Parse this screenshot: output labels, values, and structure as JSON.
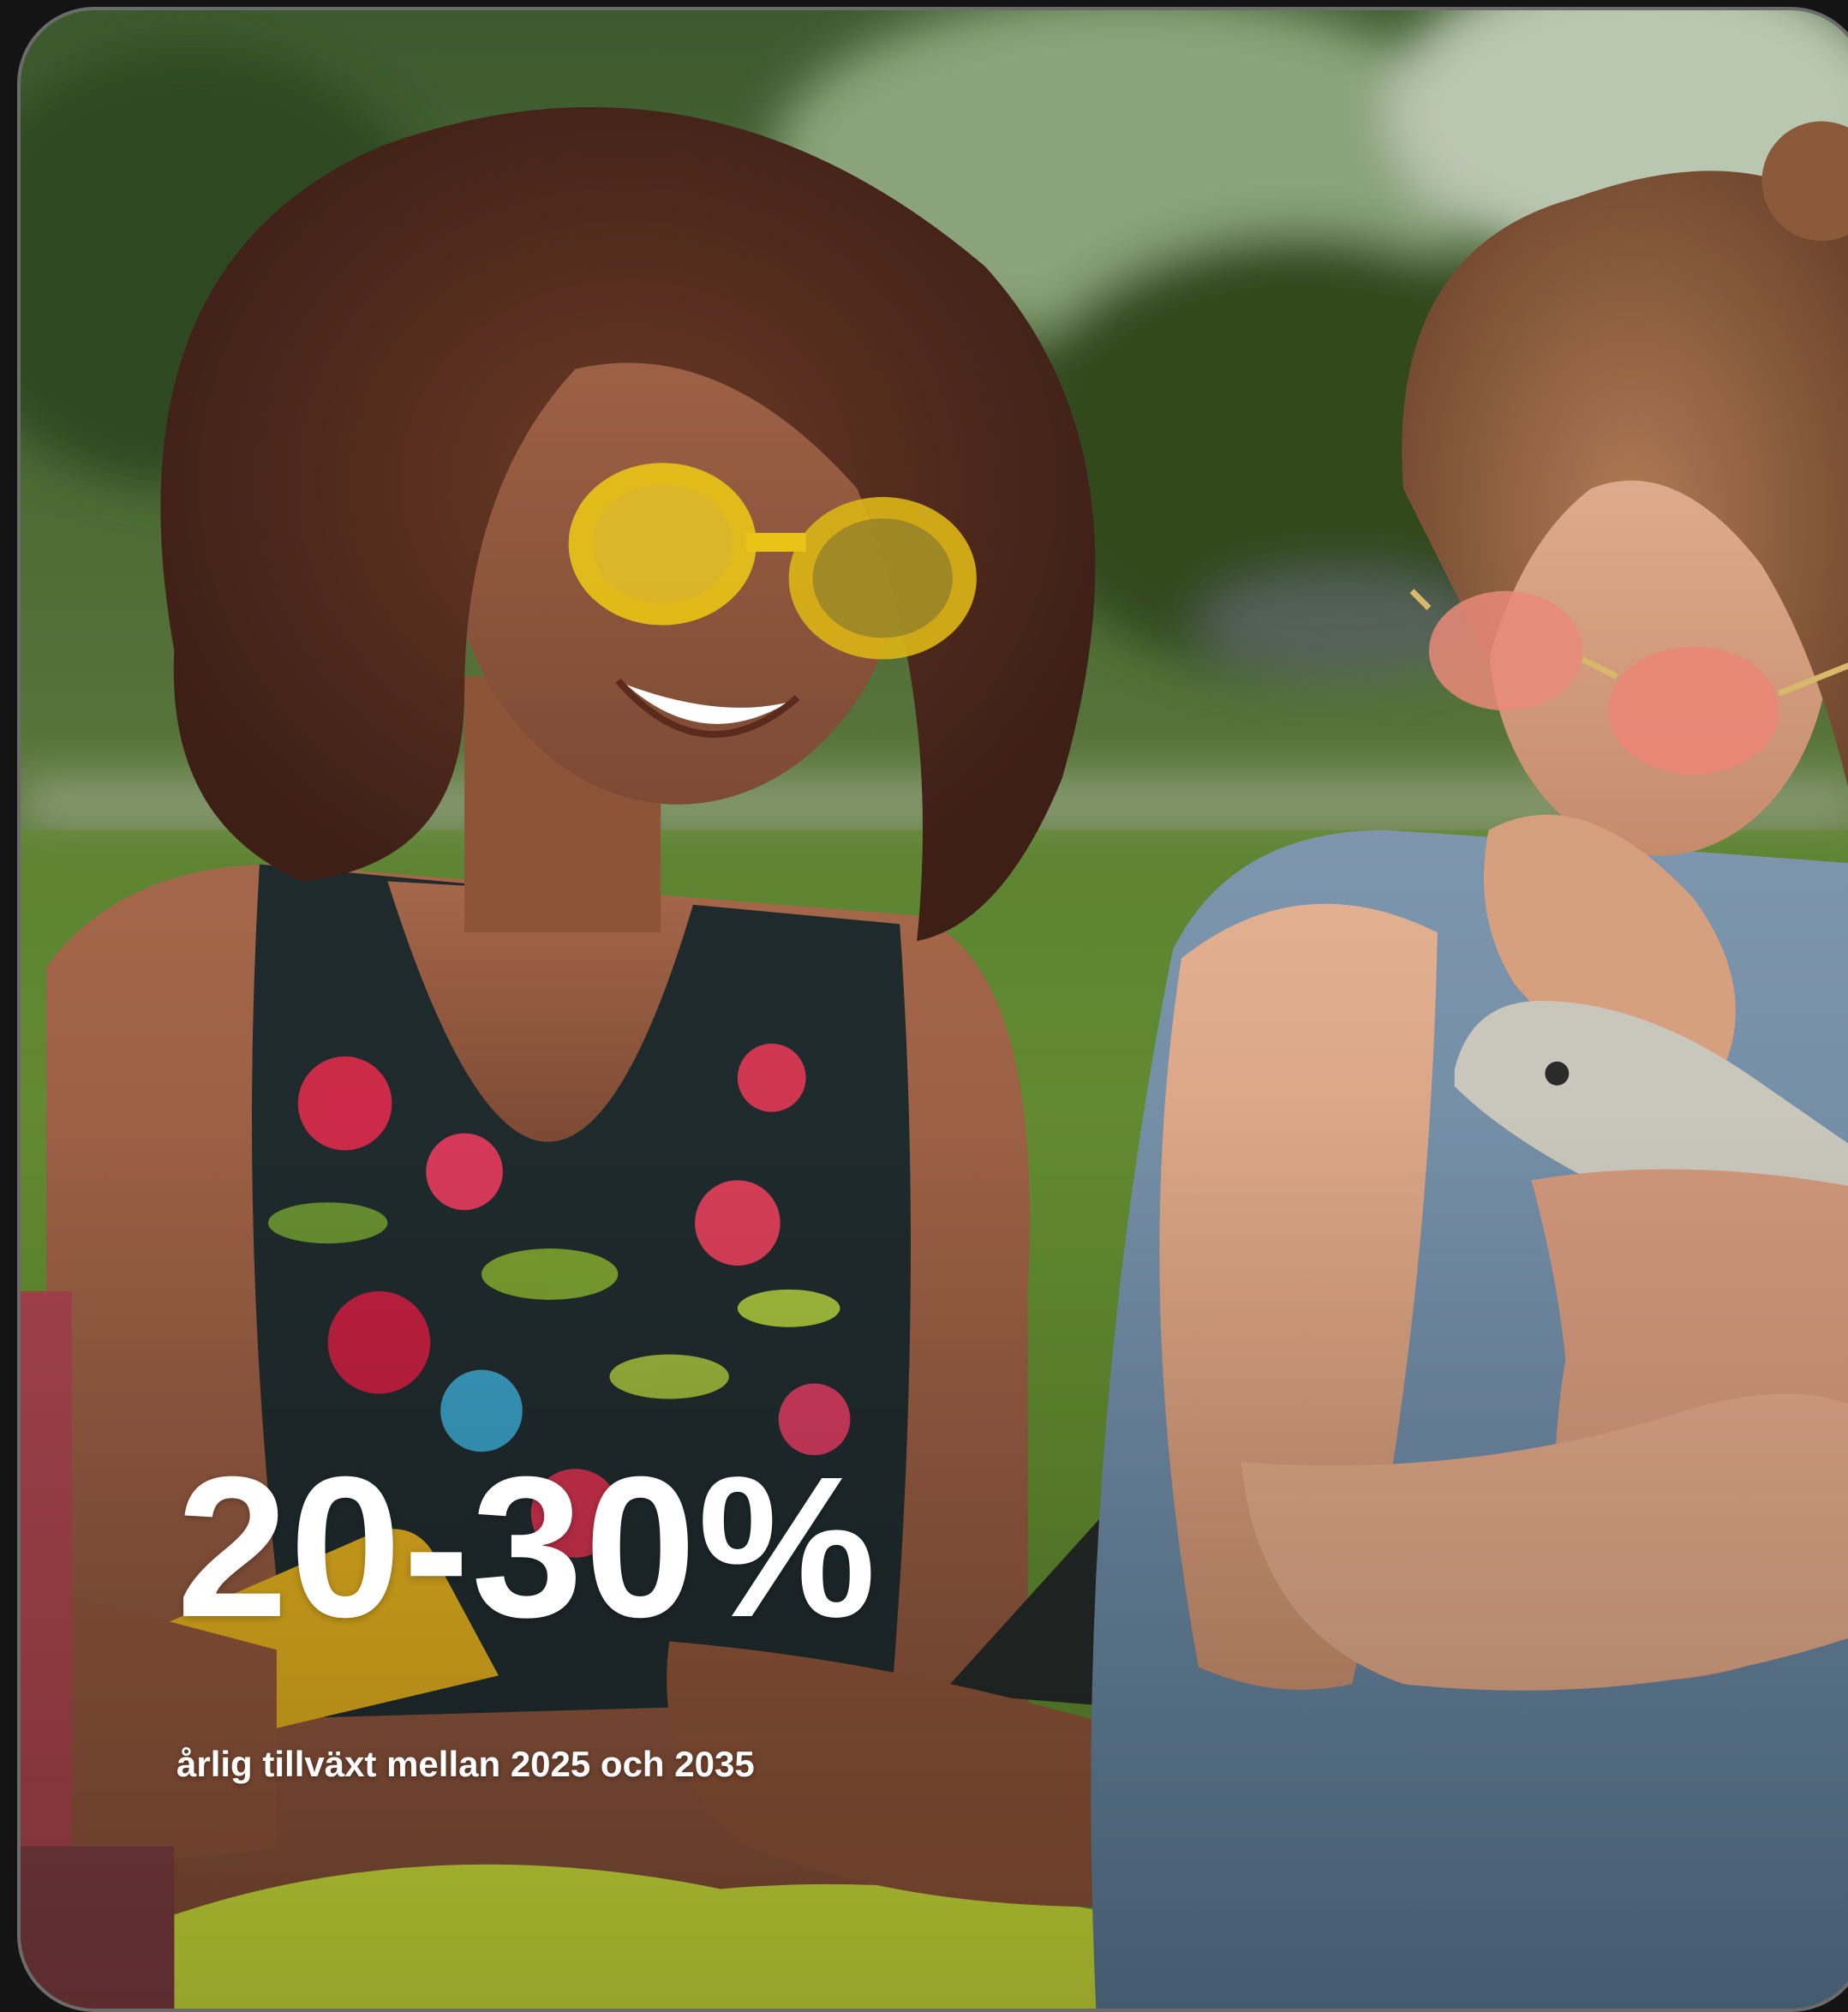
{
  "stat": {
    "value": "20-30%",
    "caption": "årlig tillväxt mellan 2025 och 2035"
  },
  "photo": {
    "subject": "two-women-with-smartphones-in-park",
    "accent_colors": {
      "grass": "#5f8a2c",
      "foliage": "#3f5b2a",
      "hair": "#5a2f22",
      "yellow_glasses": "#e3c21d",
      "pink_glasses": "#e48c7c",
      "lime_pants": "#c9dc3a",
      "denim": "#6f8fae"
    }
  }
}
